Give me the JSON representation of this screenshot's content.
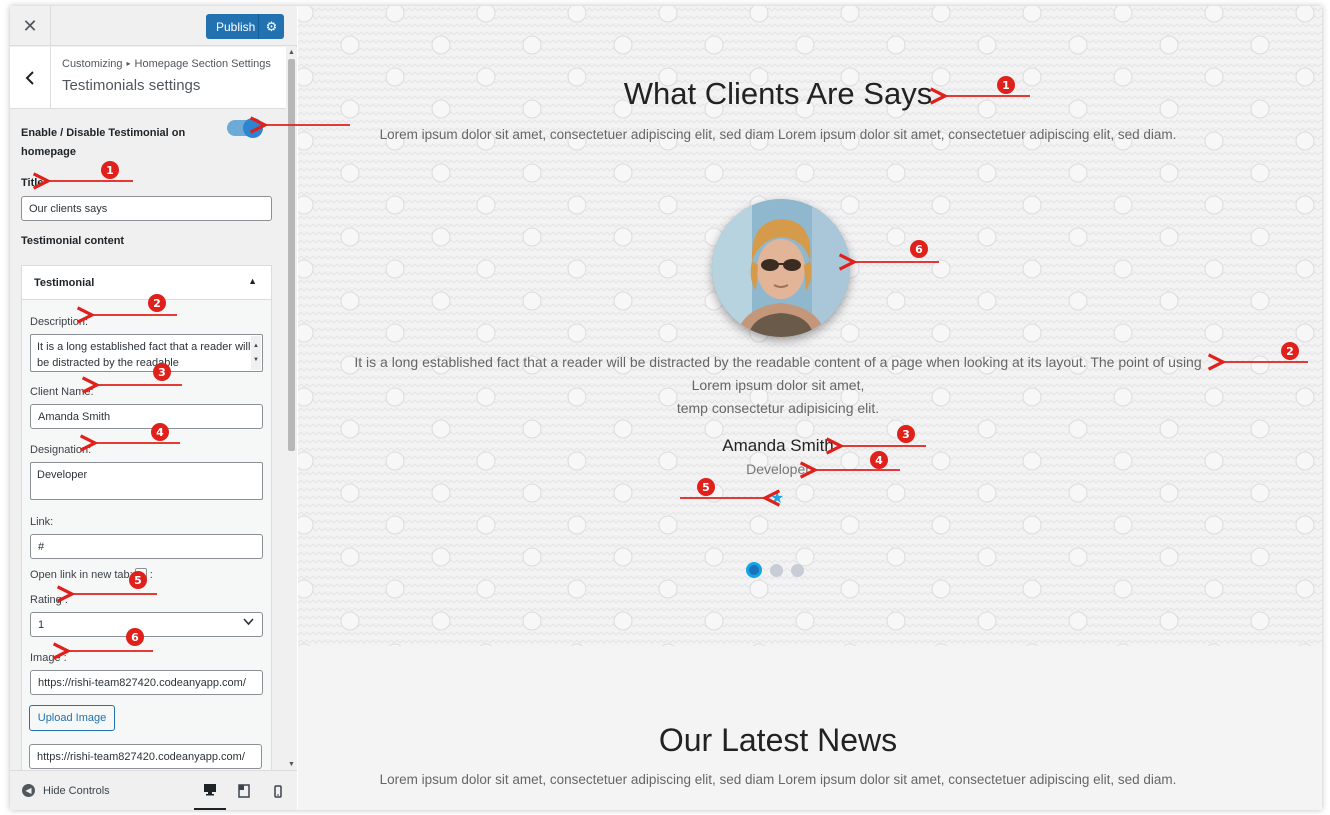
{
  "topbar": {
    "publish_label": "Publish",
    "close_icon": "close-icon",
    "gear_icon": "gear-icon"
  },
  "header": {
    "breadcrumb": [
      "Customizing",
      "Homepage Section Settings"
    ],
    "title": "Testimonials settings"
  },
  "settings": {
    "enable_label": "Enable / Disable Testimonial on homepage",
    "enable_on": true,
    "title_label": "Title",
    "title_value": "Our clients says",
    "content_label": "Testimonial content",
    "panel_label": "Testimonial",
    "description_label": "Description:",
    "description_value": "It is a long established fact that a reader will be distracted by the readable",
    "client_name_label": "Client Name:",
    "client_name_value": "Amanda Smith",
    "designation_label": "Designation:",
    "designation_value": "Developer",
    "link_label": "Link:",
    "link_value": "#",
    "new_tab_label": "Open link in new tab:",
    "new_tab_suffix": ":",
    "rating_label": "Rating :",
    "rating_value": "1",
    "image_label": "Image :",
    "image_value": "https://rishi-team827420.codeanyapp.com/",
    "upload_label": "Upload Image",
    "image_value_2": "https://rishi-team827420.codeanyapp.com/"
  },
  "footer": {
    "hide_controls_label": "Hide Controls",
    "devices": [
      "desktop-icon",
      "tablet-icon",
      "mobile-icon"
    ]
  },
  "preview": {
    "testimonial_title": "What Clients Are Says",
    "testimonial_subtitle": "Lorem ipsum dolor sit amet, consectetuer adipiscing elit, sed diam Lorem ipsum dolor sit amet, consectetuer adipiscing elit, sed diam.",
    "description_line1": "It is a long established fact that a reader will be distracted by the readable content of a page when looking at its layout. The point of using",
    "description_line2": "Lorem ipsum dolor sit amet,",
    "description_line3": "temp consectetur adipisicing elit.",
    "client_name": "Amanda Smith",
    "designation": "Developer",
    "rating": 1,
    "slider_dots": 3,
    "active_dot": 1,
    "news_title": "Our Latest News",
    "news_subtitle": "Lorem ipsum dolor sit amet, consectetuer adipiscing elit, sed diam Lorem ipsum dolor sit amet, consectetuer adipiscing elit, sed diam."
  },
  "annotations": {
    "numbers": [
      "1",
      "1",
      "2",
      "2",
      "3",
      "3",
      "4",
      "4",
      "5",
      "5",
      "6",
      "6"
    ]
  },
  "colors": {
    "accent": "#2271b1",
    "annotation": "#e0201b",
    "star": "#1ea7e4"
  }
}
